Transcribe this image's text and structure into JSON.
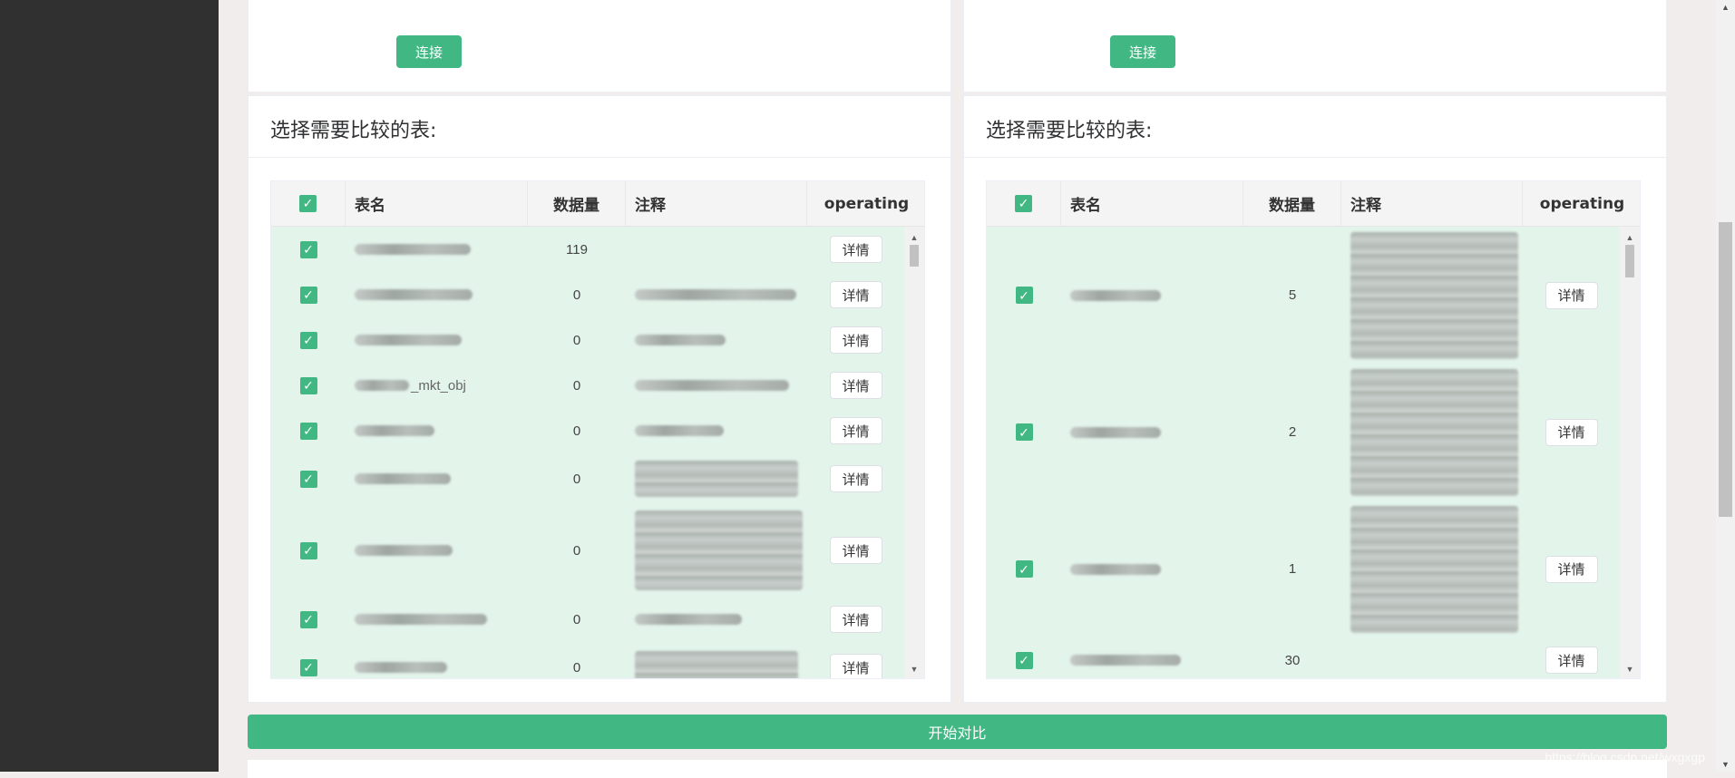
{
  "connect_label": "连接",
  "section_title": "选择需要比较的表:",
  "columns": {
    "name": "表名",
    "count": "数据量",
    "comment": "注释",
    "operating": "operating"
  },
  "detail_label": "详情",
  "checkbox_mark": "✓",
  "compare_label": "开始对比",
  "watermark": "https://blog.csdn.net/wxgxgp",
  "scroll_up_glyph": "▲",
  "scroll_down_glyph": "▼",
  "accent_color": "#41b883",
  "left_table": {
    "rows": [
      {
        "count": "119"
      },
      {
        "count": "0"
      },
      {
        "count": "0"
      },
      {
        "count": "0",
        "name_suffix": "_mkt_obj"
      },
      {
        "count": "0"
      },
      {
        "count": "0"
      },
      {
        "count": "0"
      },
      {
        "count": "0"
      },
      {
        "count": "0"
      }
    ]
  },
  "right_table": {
    "rows": [
      {
        "count": "5"
      },
      {
        "count": "2"
      },
      {
        "count": "1"
      },
      {
        "count": "30"
      }
    ]
  }
}
